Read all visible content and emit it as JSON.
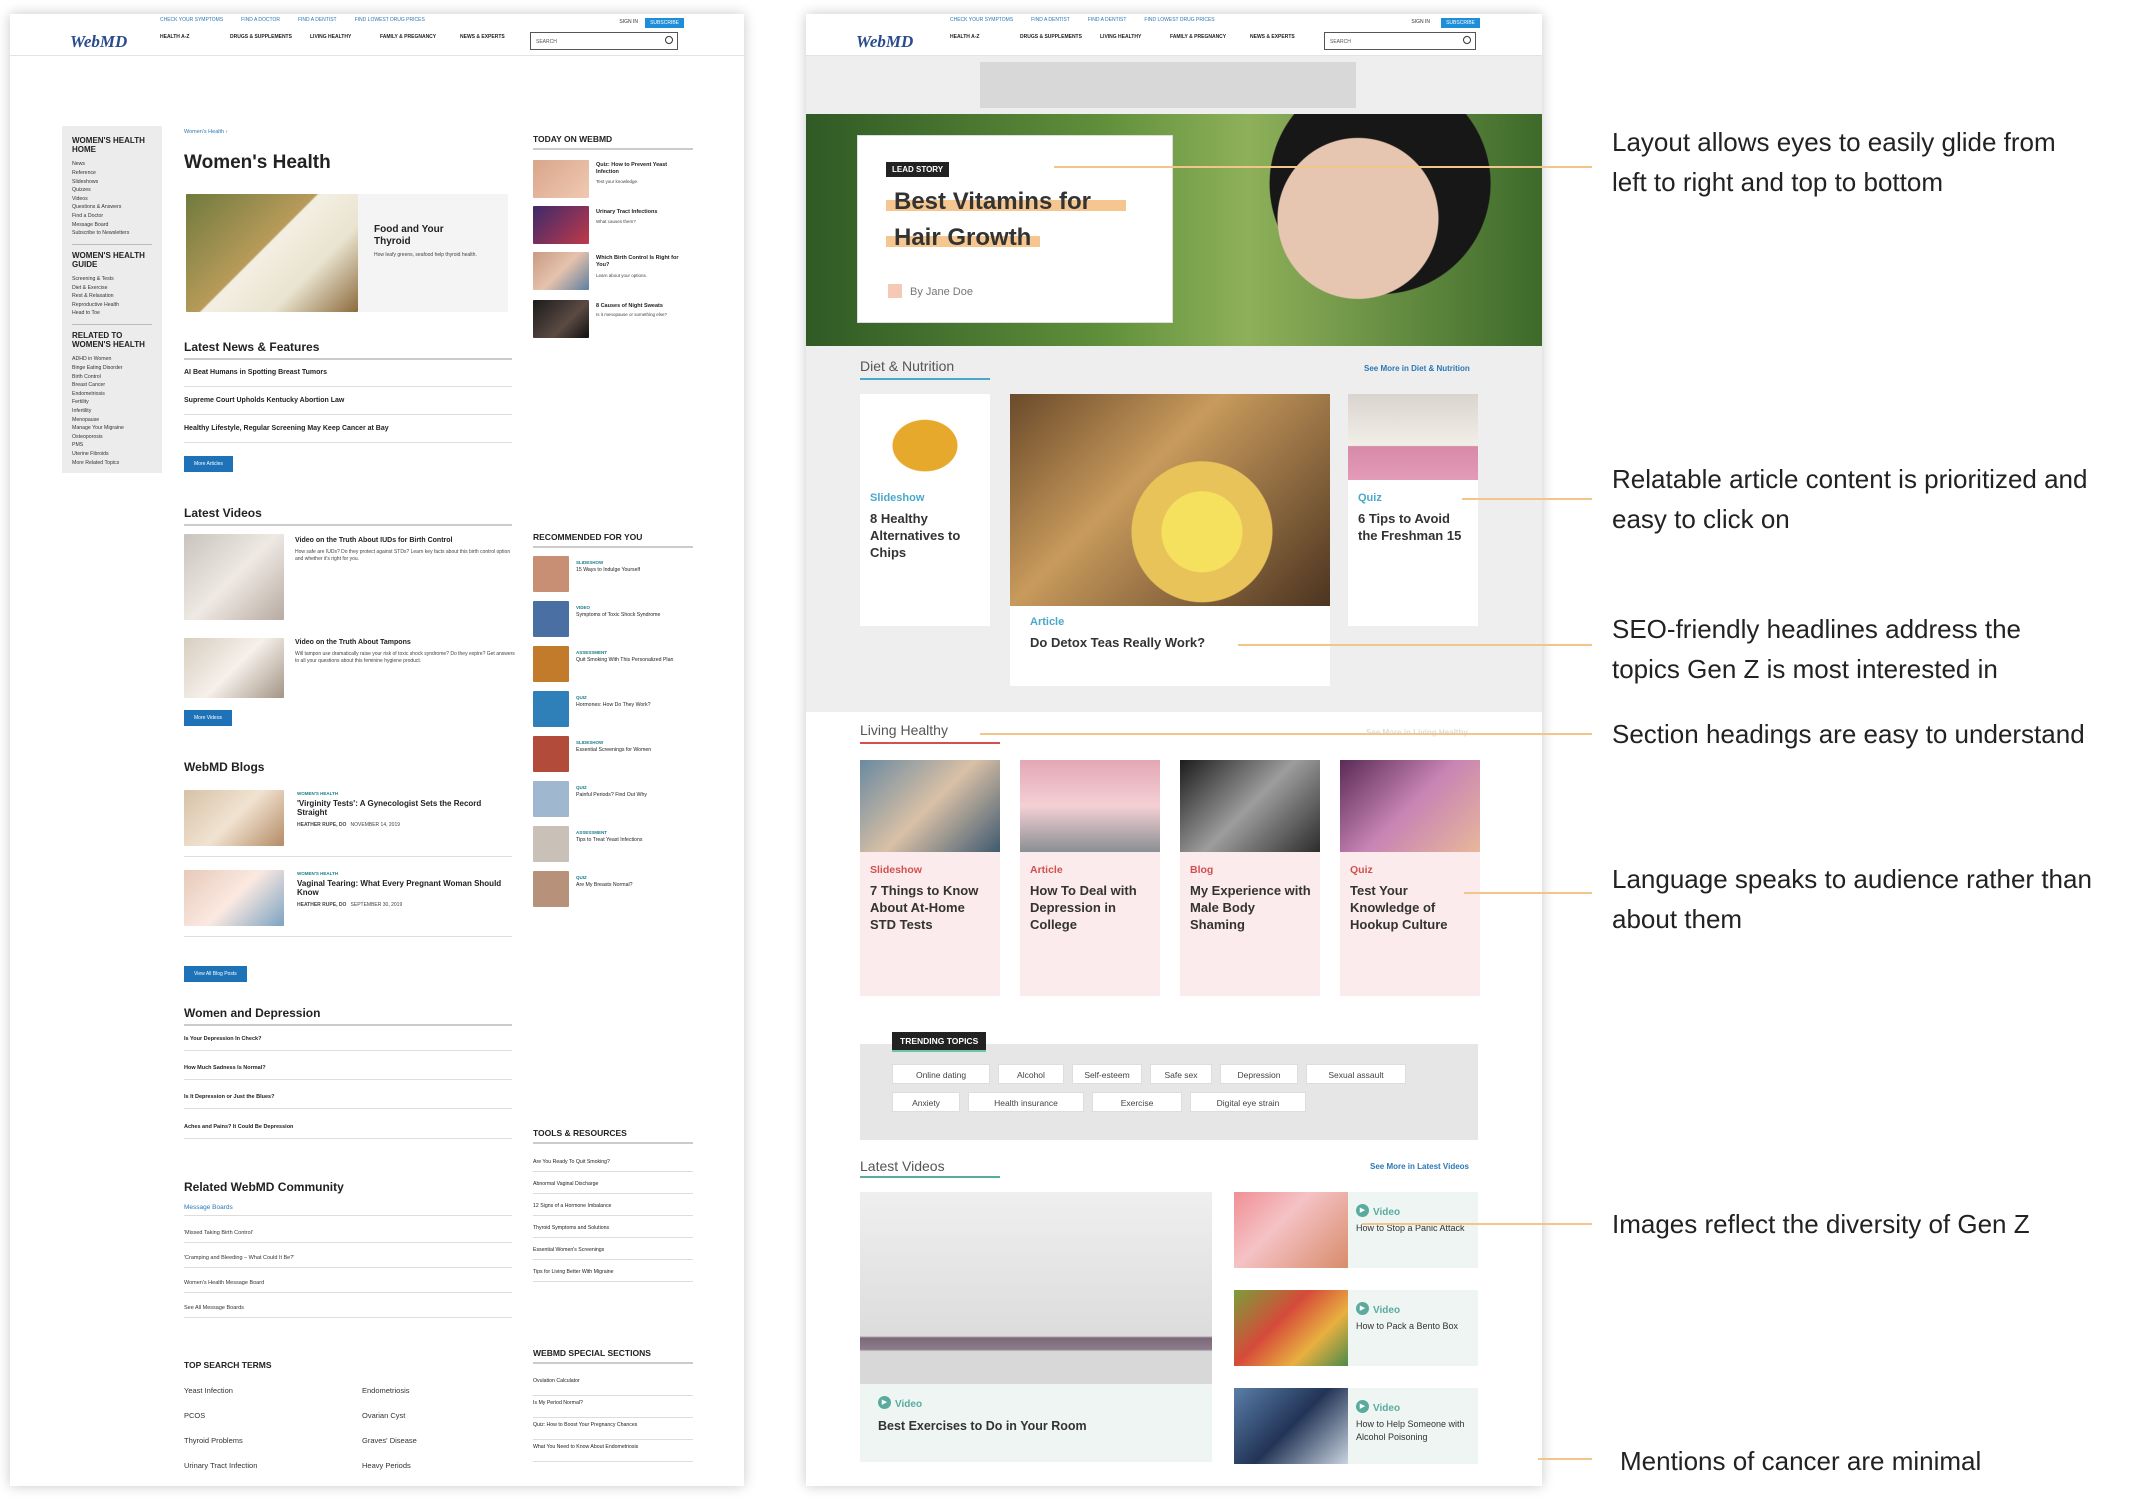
{
  "left": {
    "logo": "WebMD",
    "toplinks": [
      "CHECK YOUR SYMPTOMS",
      "FIND A DOCTOR",
      "FIND A DENTIST",
      "FIND LOWEST DRUG PRICES"
    ],
    "nav": [
      "HEALTH A-Z",
      "DRUGS & SUPPLEMENTS",
      "LIVING HEALTHY",
      "FAMILY & PREGNANCY",
      "NEWS & EXPERTS"
    ],
    "signin": "SIGN IN",
    "subscribe": "SUBSCRIBE",
    "search": "SEARCH",
    "leftnav": {
      "g1": {
        "title": "WOMEN'S HEALTH HOME",
        "items": [
          "News",
          "Reference",
          "Slideshows",
          "Quizzes",
          "Videos",
          "Questions & Answers",
          "Find a Doctor",
          "Message Board",
          "Subscribe to Newsletters"
        ]
      },
      "g2": {
        "title": "WOMEN'S HEALTH GUIDE",
        "items": [
          "Screening & Tests",
          "Diet & Exercise",
          "Rest & Relaxation",
          "Reproductive Health",
          "Head to Toe"
        ]
      },
      "g3": {
        "title": "RELATED TO WOMEN'S HEALTH",
        "items": [
          "ADHD in Women",
          "Binge Eating Disorder",
          "Birth Control",
          "Breast Cancer",
          "Endometriosis",
          "Fertility",
          "Infertility",
          "Menopause",
          "Manage Your Migraine",
          "Osteoporosis",
          "PMS",
          "Uterine Fibroids",
          "More Related Topics"
        ]
      }
    },
    "crumb": "Women's Health ›",
    "title": "Women's Health",
    "hero": {
      "title": "Food and Your Thyroid",
      "desc": "How leafy greens, seafood help thyroid health."
    },
    "latest_news": {
      "title": "Latest News & Features",
      "items": [
        "AI Beat Humans in Spotting Breast Tumors",
        "Supreme Court Upholds Kentucky Abortion Law",
        "Healthy Lifestyle, Regular Screening May Keep Cancer at Bay"
      ],
      "button": "More Articles"
    },
    "latest_videos": {
      "title": "Latest Videos",
      "items": [
        {
          "title": "Video on the Truth About IUDs for Birth Control",
          "desc": "How safe are IUDs? Do they protect against STDs? Learn key facts about this birth control option and whether it's right for you."
        },
        {
          "title": "Video on the Truth About Tampons",
          "desc": "Will tampon use dramatically raise your risk of toxic shock syndrome? Do they expire? Get answers to all your questions about this feminine hygiene product."
        }
      ],
      "button": "More Videos"
    },
    "blogs": {
      "title": "WebMD Blogs",
      "items": [
        {
          "kicker": "WOMEN'S HEALTH",
          "title": "'Virginity Tests': A Gynecologist Sets the Record Straight",
          "author": "HEATHER RUPE, DO",
          "date": "NOVEMBER 14, 2019"
        },
        {
          "kicker": "WOMEN'S HEALTH",
          "title": "Vaginal Tearing: What Every Pregnant Woman Should Know",
          "author": "HEATHER RUPE, DO",
          "date": "SEPTEMBER 30, 2019"
        }
      ],
      "button": "View All Blog Posts"
    },
    "depression": {
      "title": "Women and Depression",
      "items": [
        "Is Your Depression In Check?",
        "How Much Sadness Is Normal?",
        "Is It Depression or Just the Blues?",
        "Aches and Pains? It Could Be Depression"
      ]
    },
    "community": {
      "title": "Related WebMD Community",
      "link": "Message Boards",
      "items": [
        "'Missed Taking Birth Control'",
        "'Cramping and Bleeding – What Could It Be?'",
        "Women's Health Message Board",
        "See All Message Boards"
      ]
    },
    "topsearch": {
      "title": "TOP SEARCH TERMS",
      "items": [
        "Yeast Infection",
        "Endometriosis",
        "PCOS",
        "Ovarian Cyst",
        "Thyroid Problems",
        "Graves' Disease",
        "Urinary Tract Infection",
        "Heavy Periods"
      ]
    },
    "today": {
      "title": "TODAY ON WEBMD",
      "items": [
        {
          "title": "Quiz: How to Prevent Yeast Infection",
          "desc": "Test your knowledge."
        },
        {
          "title": "Urinary Tract Infections",
          "desc": "What causes them?"
        },
        {
          "title": "Which Birth Control Is Right for You?",
          "desc": "Learn about your options."
        },
        {
          "title": "8 Causes of Night Sweats",
          "desc": "Is it menopause or something else?"
        }
      ]
    },
    "recommended": {
      "title": "RECOMMENDED FOR YOU",
      "items": [
        {
          "kicker": "SLIDESHOW",
          "text": "15 Ways to Indulge Yourself"
        },
        {
          "kicker": "VIDEO",
          "text": "Symptoms of Toxic Shock Syndrome"
        },
        {
          "kicker": "ASSESSMENT",
          "text": "Quit Smoking With This Personalized Plan"
        },
        {
          "kicker": "QUIZ",
          "text": "Hormones: How Do They Work?"
        },
        {
          "kicker": "SLIDESHOW",
          "text": "Essential Screenings for Women"
        },
        {
          "kicker": "QUIZ",
          "text": "Painful Periods? Find Out Why"
        },
        {
          "kicker": "ASSESSMENT",
          "text": "Tips to Treat Yeast Infections"
        },
        {
          "kicker": "QUIZ",
          "text": "Are My Breasts Normal?"
        }
      ]
    },
    "tools": {
      "title": "TOOLS & RESOURCES",
      "items": [
        "Are You Ready To Quit Smoking?",
        "Abnormal Vaginal Discharge",
        "12 Signs of a Hormone Imbalance",
        "Thyroid Symptoms and Solutions",
        "Essential Women's Screenings",
        "Tips for Living Better With Migraine"
      ]
    },
    "special": {
      "title": "WEBMD SPECIAL SECTIONS",
      "items": [
        "Ovulation Calculator",
        "Is My Period Normal?",
        "Quiz: How to Boost Your Pregnancy Chances",
        "What You Need to Know About Endometriosis"
      ]
    }
  },
  "right": {
    "logo": "WebMD",
    "toplinks": [
      "CHECK YOUR SYMPTOMS",
      "FIND A DENTIST",
      "FIND A DENTIST",
      "FIND LOWEST DRUG PRICES"
    ],
    "nav": [
      "HEALTH A-Z",
      "DRUGS & SUPPLEMENTS",
      "LIVING HEALTHY",
      "FAMILY & PREGNANCY",
      "NEWS & EXPERTS"
    ],
    "signin": "SIGN IN",
    "subscribe": "SUBSCRIBE",
    "search": "SEARCH",
    "lead": {
      "badge": "LEAD STORY",
      "title1": "Best Vitamins for",
      "title2": "Hair Growth",
      "byline": "By Jane Doe"
    },
    "diet": {
      "title": "Diet & Nutrition",
      "seemore": "See More in Diet & Nutrition",
      "cards": [
        {
          "tag": "Slideshow",
          "title": "8 Healthy Alternatives to Chips"
        },
        {
          "tag": "Article",
          "title": "Do Detox Teas Really Work?"
        },
        {
          "tag": "Quiz",
          "title": "6 Tips to Avoid the Freshman 15"
        }
      ]
    },
    "living": {
      "title": "Living Healthy",
      "seemore": "See More in Living Healthy",
      "cards": [
        {
          "tag": "Slideshow",
          "title": "7 Things to Know About At-Home STD Tests"
        },
        {
          "tag": "Article",
          "title": "How To Deal with Depression in College"
        },
        {
          "tag": "Blog",
          "title": "My Experience with Male Body Shaming"
        },
        {
          "tag": "Quiz",
          "title": "Test Your Knowledge of Hookup Culture"
        }
      ]
    },
    "trending": {
      "title": "TRENDING TOPICS",
      "row1": [
        "Online dating",
        "Alcohol",
        "Self-esteem",
        "Safe sex",
        "Depression",
        "Sexual assault"
      ],
      "row2": [
        "Anxiety",
        "Health insurance",
        "Exercise",
        "Digital eye strain"
      ]
    },
    "videos": {
      "title": "Latest Videos",
      "seemore": "See More in Latest Videos",
      "main": {
        "tag": "Video",
        "title": "Best Exercises to Do in Your Room"
      },
      "items": [
        {
          "tag": "Video",
          "title": "How to Stop a Panic Attack"
        },
        {
          "tag": "Video",
          "title": "How to Pack a Bento Box"
        },
        {
          "tag": "Video",
          "title": "How to Help Someone with Alcohol Poisoning"
        }
      ]
    }
  },
  "annotations": [
    {
      "l1": "Layout allows eyes to easily glide from",
      "l2": "left to right and top to bottom"
    },
    {
      "l1": "Relatable article content is prioritized and",
      "l2": "easy to click on"
    },
    {
      "l1": "SEO-friendly headlines address the",
      "l2": "topics Gen Z is most interested in"
    },
    {
      "l1": "Section headings are easy to understand",
      "l2": ""
    },
    {
      "l1": "Language speaks to audience rather than",
      "l2": "about them"
    },
    {
      "l1": "Images reflect the diversity of Gen Z",
      "l2": ""
    },
    {
      "l1": "Mentions of cancer are minimal",
      "l2": ""
    }
  ],
  "colors": {
    "accent_blue": "#1e73b8",
    "link_blue": "#2b78b5",
    "tag_blue": "#4aa9c9",
    "pink_card": "#fbebec",
    "tag_red": "#d2504e",
    "video_green": "#5aab9e",
    "highlight": "#f2c58a"
  }
}
